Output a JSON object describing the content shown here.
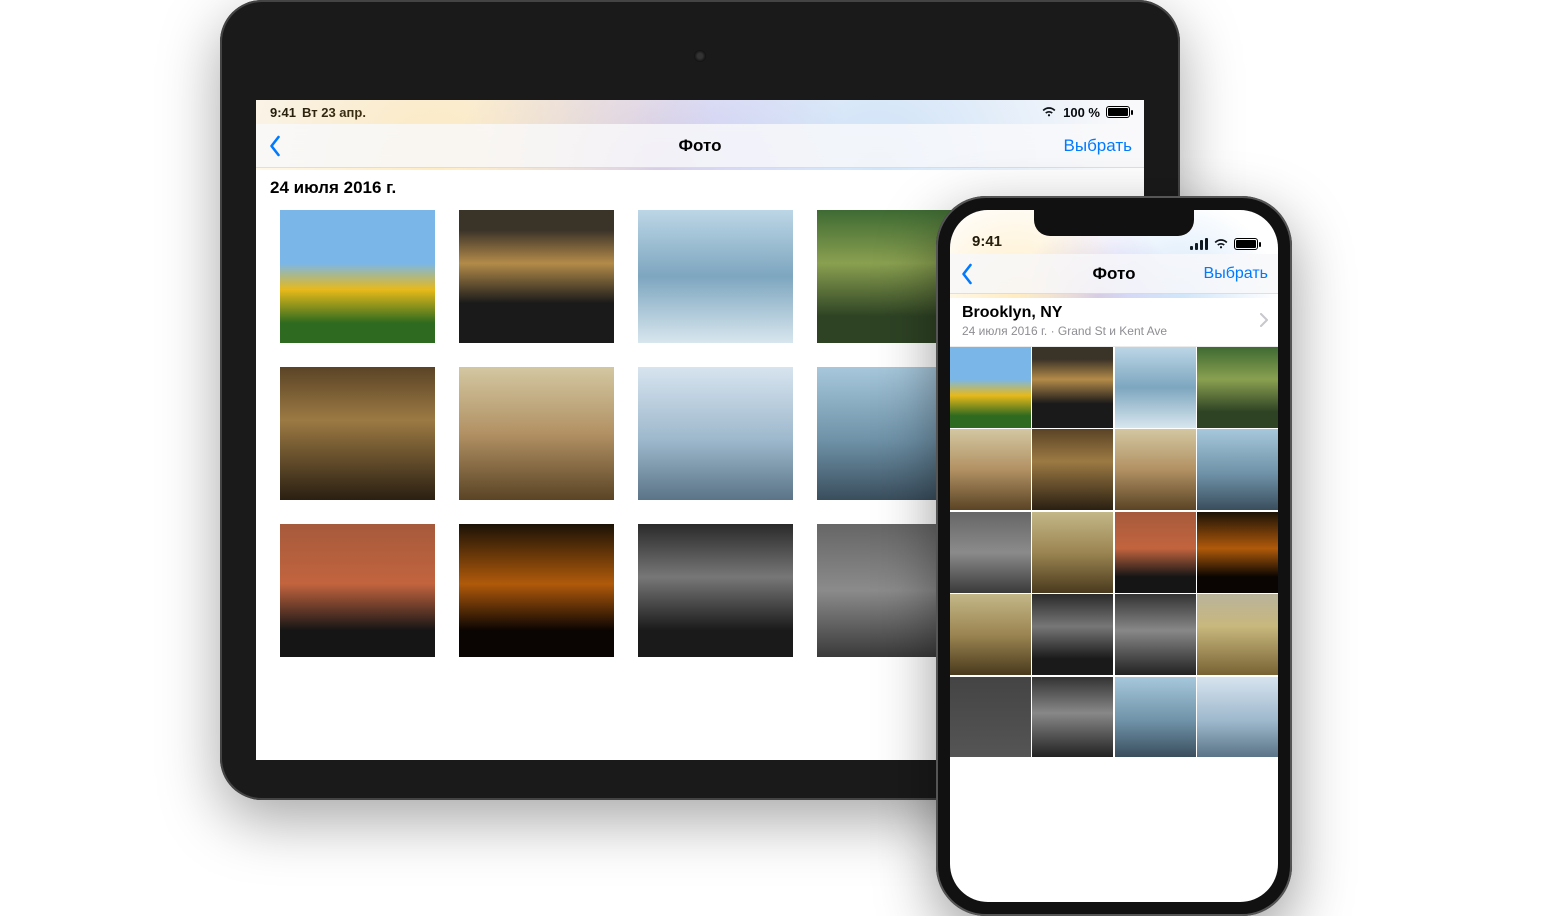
{
  "ipad": {
    "status": {
      "time": "9:41",
      "date": "Вт 23 апр.",
      "battery_pct": "100 %"
    },
    "nav": {
      "title": "Фото",
      "select": "Выбрать"
    },
    "section_date": "24 июля 2016 г."
  },
  "iphone": {
    "status": {
      "time": "9:41"
    },
    "nav": {
      "title": "Фото",
      "select": "Выбрать"
    },
    "section": {
      "location": "Brooklyn, NY",
      "subtitle": "24 июля 2016 г.  ·  Grand St и Kent Ave"
    }
  }
}
